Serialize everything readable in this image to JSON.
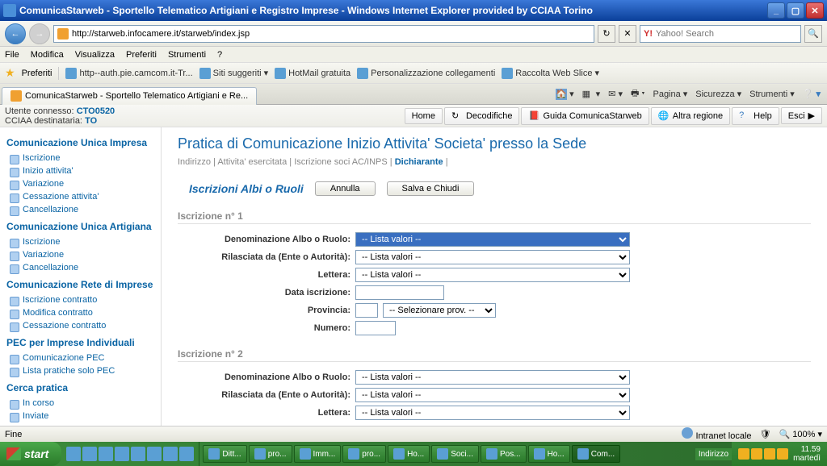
{
  "window": {
    "title": "ComunicaStarweb - Sportello Telematico Artigiani e Registro Imprese - Windows Internet Explorer provided by CCIAA Torino"
  },
  "nav": {
    "url": "http://starweb.infocamere.it/starweb/index.jsp",
    "search_placeholder": "Yahoo! Search"
  },
  "menu": [
    "File",
    "Modifica",
    "Visualizza",
    "Preferiti",
    "Strumenti",
    "?"
  ],
  "favorites": {
    "label": "Preferiti",
    "items": [
      "http--auth.pie.camcom.it-Tr...",
      "Siti suggeriti",
      "HotMail gratuita",
      "Personalizzazione collegamenti",
      "Raccolta Web Slice"
    ]
  },
  "tab": {
    "title": "ComunicaStarweb - Sportello Telematico Artigiani e Re..."
  },
  "tabbar_right": [
    "Pagina",
    "Sicurezza",
    "Strumenti"
  ],
  "app_header": {
    "user_label": "Utente connesso:",
    "user": "CTO0520",
    "cciaa_label": "CCIAA destinataria:",
    "cciaa": "TO",
    "buttons": {
      "home": "Home",
      "decod": "Decodifiche",
      "guida": "Guida ComunicaStarweb",
      "regione": "Altra regione",
      "help": "Help",
      "esci": "Esci"
    }
  },
  "sidebar": {
    "g1": {
      "title": "Comunicazione Unica Impresa",
      "items": [
        "Iscrizione",
        "Inizio attivita'",
        "Variazione",
        "Cessazione attivita'",
        "Cancellazione"
      ]
    },
    "g2": {
      "title": "Comunicazione Unica Artigiana",
      "items": [
        "Iscrizione",
        "Variazione",
        "Cancellazione"
      ]
    },
    "g3": {
      "title": "Comunicazione Rete di Imprese",
      "items": [
        "Iscrizione contratto",
        "Modifica contratto",
        "Cessazione contratto"
      ]
    },
    "g4": {
      "title": "PEC per Imprese Individuali",
      "items": [
        "Comunicazione PEC",
        "Lista pratiche solo PEC"
      ]
    },
    "g5": {
      "title": "Cerca pratica",
      "items": [
        "In corso",
        "Inviate"
      ]
    }
  },
  "content": {
    "title": "Pratica di Comunicazione Inizio Attivita' Societa' presso la Sede",
    "breadcrumb": [
      "Indirizzo",
      "Attivita' esercitata",
      "Iscrizione soci AC/INPS",
      "Dichiarante"
    ],
    "section_title": "Iscrizioni Albi o Ruoli",
    "btn_cancel": "Annulla",
    "btn_save": "Salva e Chiudi",
    "subsec1": "Iscrizione n° 1",
    "subsec2": "Iscrizione n° 2",
    "labels": {
      "denom": "Denominazione Albo o Ruolo:",
      "rilasc": "Rilasciata da (Ente o Autorità):",
      "lettera": "Lettera:",
      "data": "Data iscrizione:",
      "prov": "Provincia:",
      "numero": "Numero:"
    },
    "opt_lista": "-- Lista valori --",
    "opt_prov": "-- Selezionare prov. --"
  },
  "statusbar": {
    "left": "Fine",
    "zone": "Intranet locale",
    "zoom": "100%"
  },
  "taskbar": {
    "start": "start",
    "items": [
      "Ditt...",
      "pro...",
      "Imm...",
      "pro...",
      "Ho...",
      "Soci...",
      "Pos...",
      "Ho...",
      "Com..."
    ],
    "lang": "Indirizzo",
    "time": "11.59",
    "day": "martedì"
  }
}
